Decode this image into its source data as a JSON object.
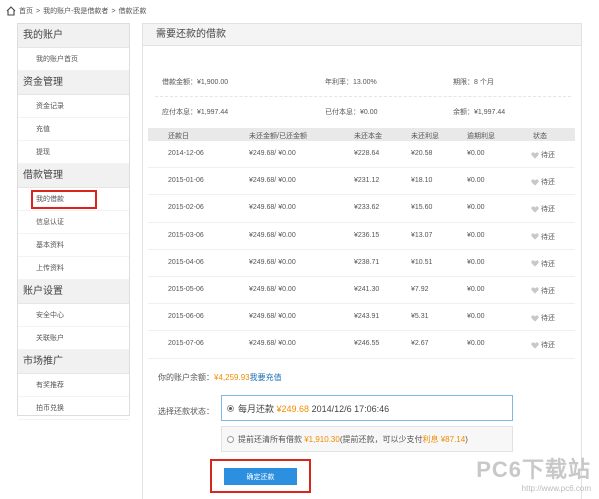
{
  "breadcrumb": {
    "home": "首页",
    "sep": ">",
    "account": "我的账户-我是借款者",
    "current": "借款还款"
  },
  "sidebar": {
    "groups": [
      {
        "title": "我的账户",
        "items": [
          "我的账户首页"
        ]
      },
      {
        "title": "资金管理",
        "items": [
          "资金记录",
          "充值",
          "提现"
        ]
      },
      {
        "title": "借款管理",
        "items": [
          "我的借款",
          "信息认证",
          "基本资料",
          "上传资料"
        ]
      },
      {
        "title": "账户设置",
        "items": [
          "安全中心",
          "关联账户"
        ]
      },
      {
        "title": "市场推广",
        "items": [
          "有奖推荐",
          "拍币兑换"
        ]
      }
    ]
  },
  "main": {
    "title": "需要还款的借款",
    "summary": {
      "loan_amount": "借款金额：¥1,900.00",
      "annual_rate": "年利率：13.00%",
      "term": "期限：8 个月",
      "total_due": "应付本息：¥1,997.44",
      "paid": "已付本息：¥0.00",
      "remaining": "余额：¥1,997.44"
    },
    "table": {
      "headers": [
        "还款日",
        "未还金额/已还金额",
        "未还本金",
        "未还利息",
        "逾期利息",
        "状态"
      ],
      "rows": [
        [
          "2014-12-06",
          "¥249.68/ ¥0.00",
          "¥228.64",
          "¥20.58",
          "¥0.00",
          "待还"
        ],
        [
          "2015-01-06",
          "¥249.68/ ¥0.00",
          "¥231.12",
          "¥18.10",
          "¥0.00",
          "待还"
        ],
        [
          "2015-02-06",
          "¥249.68/ ¥0.00",
          "¥233.62",
          "¥15.60",
          "¥0.00",
          "待还"
        ],
        [
          "2015-03-06",
          "¥249.68/ ¥0.00",
          "¥236.15",
          "¥13.07",
          "¥0.00",
          "待还"
        ],
        [
          "2015-04-06",
          "¥249.68/ ¥0.00",
          "¥238.71",
          "¥10.51",
          "¥0.00",
          "待还"
        ],
        [
          "2015-05-06",
          "¥249.68/ ¥0.00",
          "¥241.30",
          "¥7.92",
          "¥0.00",
          "待还"
        ],
        [
          "2015-06-06",
          "¥249.68/ ¥0.00",
          "¥243.91",
          "¥5.31",
          "¥0.00",
          "待还"
        ],
        [
          "2015-07-06",
          "¥249.68/ ¥0.00",
          "¥246.55",
          "¥2.67",
          "¥0.00",
          "待还"
        ]
      ]
    },
    "balance": {
      "label": "你的账户余额：",
      "amount": "¥4,259.93",
      "recharge": "我要充值"
    },
    "choose_label": "选择还款状态：",
    "option_monthly": {
      "prefix": "每月还款 ",
      "amount": "¥249.68",
      "suffix": " 2014/12/6 17:06:46"
    },
    "option_early": {
      "prefix": "提前还清所有借款 ",
      "amount": "¥1,910.30",
      "mid": "(提前还款，可以少支付",
      "interest_label": "利息",
      "saved": " ¥87.14",
      "end": ")"
    },
    "confirm_button": "确定还款"
  },
  "watermark": {
    "brand": "PC6下载站",
    "url": "http://www.pc6.com"
  },
  "colors": {
    "accent": "#2c8fe0",
    "highlight_box": "#d9261c",
    "amount": "#f08c00",
    "link": "#1e6fb8"
  }
}
